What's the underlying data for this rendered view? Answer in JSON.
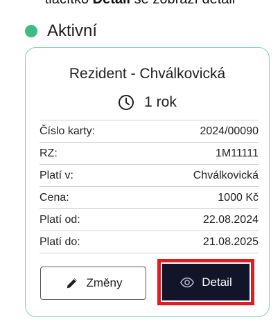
{
  "caption": {
    "prefix": "tlačítko ",
    "bold": "Detail",
    "suffix": " se zobrazí detail"
  },
  "status": {
    "label": "Aktivní",
    "dot_color": "#3dbb82"
  },
  "card": {
    "title": "Rezident - Chválkovická",
    "duration_icon": "clock-icon",
    "duration": "1 rok",
    "rows": [
      {
        "label": "Číslo karty:",
        "value": "2024/00090"
      },
      {
        "label": "RZ:",
        "value": "1M11111"
      },
      {
        "label": "Platí v:",
        "value": "Chválkovická"
      },
      {
        "label": "Cena:",
        "value": "1000 Kč"
      },
      {
        "label": "Platí od:",
        "value": "22.08.2024"
      },
      {
        "label": "Platí do:",
        "value": "21.08.2025"
      }
    ],
    "changes_button": {
      "icon": "pencil-icon",
      "label": "Změny"
    },
    "detail_button": {
      "icon": "eye-icon",
      "label": "Detail",
      "highlight_color": "#e31b23"
    }
  }
}
